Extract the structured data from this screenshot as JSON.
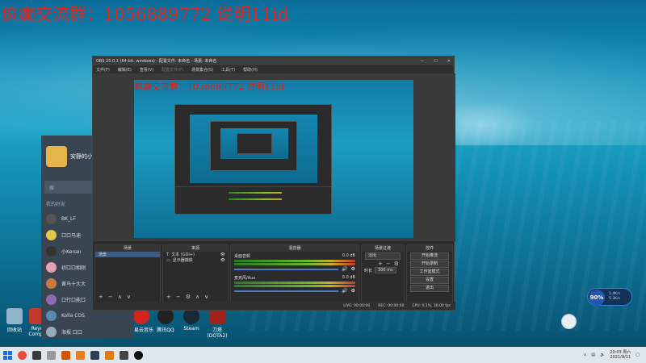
{
  "watermark": "疯癫交流群：1056889772 说明11id",
  "desktop_icons": [
    {
      "label": "回收站",
      "color": "#8fb3c9"
    },
    {
      "label": "Reyo Compo",
      "color": "#c0392b"
    },
    {
      "label": "网易云音乐",
      "color": "#d1241c"
    },
    {
      "label": "腾讯QQ",
      "color": "#222"
    },
    {
      "label": "Steam",
      "color": "#1b2838"
    },
    {
      "label": "刀塔 (DOTA2)",
      "color": "#a1221b"
    }
  ],
  "chat_panel": {
    "profile_name": "安静的小",
    "search_placeholder": "搜",
    "group_label": "我的好友",
    "contacts": [
      "BK_LF",
      "口口马迪",
      "小Kenan",
      "初口口相刚",
      "黄马十大大",
      "口行口能口",
      "Kolla COS",
      "海报  口口"
    ]
  },
  "obs": {
    "title": "OBS 25.0.1 (64-bit, windows) - 配置文件: 未命名 - 场景: 未命名",
    "window_controls": [
      "—",
      "☐",
      "✕"
    ],
    "menu": [
      "文件(F)",
      "编辑(E)",
      "查看(V)",
      "配置文件(P)",
      "场景集合(S)",
      "工具(T)",
      "帮助(H)"
    ],
    "preview_watermark": "疯癫交流群：1056889772 说明11id",
    "docks": {
      "scenes": {
        "title": "场景",
        "items": [
          "场景"
        ]
      },
      "sources": {
        "title": "来源",
        "items": [
          "文本 (GDI+)",
          "显示器捕获"
        ]
      },
      "mixer": {
        "title": "混音器",
        "channels": [
          {
            "name": "桌面音频",
            "db": "0.0 dB"
          },
          {
            "name": "麦克风/Aux",
            "db": "0.0 dB"
          }
        ]
      },
      "transitions": {
        "title": "场景过渡",
        "type": "淡出",
        "duration_label": "时长",
        "duration_value": "300 ms"
      },
      "controls": {
        "title": "控件",
        "buttons": [
          "开始推流",
          "开始录制",
          "工作室模式",
          "设置",
          "退出"
        ]
      }
    },
    "status": [
      "LIVE: 00:00:00",
      "REC: 00:00:00",
      "CPU: 0.1%, 30.00 fps"
    ],
    "footer_glyphs": [
      "+",
      "−",
      "⚙",
      "∧",
      "∨"
    ]
  },
  "net_widget": {
    "percent": "90%",
    "up": "1.4K/s",
    "down": "5.3K/s"
  },
  "taskbar": {
    "icon_colors": [
      "#1e6fd9",
      "#e74c3c",
      "#3a3a3a",
      "#999",
      "#d35400",
      "#e67e22",
      "#2c3e50",
      "#e07b10",
      "#444",
      "#111"
    ],
    "time": "20:03 周六",
    "date": "2021/9/11"
  }
}
